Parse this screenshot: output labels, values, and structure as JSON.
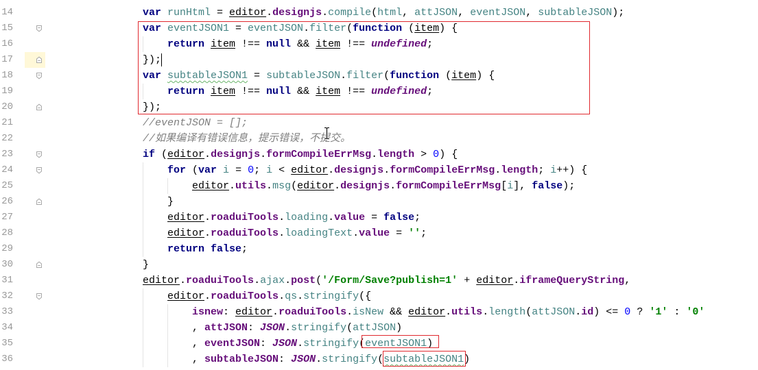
{
  "colors": {
    "background": "#FFFFFF",
    "line_number": "#999999",
    "plain": "#000000",
    "keyword": "#000080",
    "field": "#660E7A",
    "local_variable": "#458383",
    "string": "#008000",
    "number": "#0000FF",
    "comment": "#808080",
    "typo_underline": "#6AB56A",
    "indent_guide": "#E4E4E4",
    "fold_marker": "#A8A8A8",
    "caret_row": "#FFF8D8",
    "caret": "#000000",
    "annotation_box": "#E0282E"
  },
  "icons": {
    "fold_start": "fold-expanded-icon",
    "fold_end": "fold-end-icon",
    "mouse_cursor": "text-cursor-icon"
  },
  "editor": {
    "lines": [
      {
        "number": "14",
        "tokens": [
          "var ",
          "runHtml",
          " = ",
          "editor",
          ".",
          "designjs",
          ".",
          "compile",
          "(",
          "html",
          ", ",
          "attJSON",
          ", ",
          "eventJSON",
          ", ",
          "subtableJSON",
          ");"
        ]
      },
      {
        "number": "15",
        "tokens": [
          "var ",
          "eventJSON1",
          " = ",
          "eventJSON",
          ".",
          "filter",
          "(",
          "function ",
          "(",
          "item",
          ") {"
        ]
      },
      {
        "number": "16",
        "tokens": [
          "return ",
          "item",
          " !== ",
          "null",
          " && ",
          "item",
          " !== ",
          "undefined",
          ";"
        ]
      },
      {
        "number": "17",
        "tokens": [
          "});"
        ]
      },
      {
        "number": "18",
        "tokens": [
          "var ",
          "subtableJSON1",
          " = ",
          "subtableJSON",
          ".",
          "filter",
          "(",
          "function ",
          "(",
          "item",
          ") {"
        ]
      },
      {
        "number": "19",
        "tokens": [
          "return ",
          "item",
          " !== ",
          "null",
          " && ",
          "item",
          " !== ",
          "undefined",
          ";"
        ]
      },
      {
        "number": "20",
        "tokens": [
          "});"
        ]
      },
      {
        "number": "21",
        "tokens": [
          "//eventJSON = [];"
        ]
      },
      {
        "number": "22",
        "tokens": [
          "//如果编译有错误信息，提示错误，不提交。"
        ]
      },
      {
        "number": "23",
        "tokens": [
          "if ",
          "(",
          "editor",
          ".",
          "designjs",
          ".",
          "formCompileErrMsg",
          ".",
          "length",
          " > ",
          "0",
          ") {"
        ]
      },
      {
        "number": "24",
        "tokens": [
          "for ",
          "(",
          "var ",
          "i",
          " = ",
          "0",
          "; ",
          "i",
          " < ",
          "editor",
          ".",
          "designjs",
          ".",
          "formCompileErrMsg",
          ".",
          "length",
          "; ",
          "i",
          "++) {"
        ]
      },
      {
        "number": "25",
        "tokens": [
          "editor",
          ".",
          "utils",
          ".",
          "msg",
          "(",
          "editor",
          ".",
          "designjs",
          ".",
          "formCompileErrMsg",
          "[",
          "i",
          "], ",
          "false",
          ");"
        ]
      },
      {
        "number": "26",
        "tokens": [
          "}"
        ]
      },
      {
        "number": "27",
        "tokens": [
          "editor",
          ".",
          "roaduiTools",
          ".",
          "loading",
          ".",
          "value",
          " = ",
          "false",
          ";"
        ]
      },
      {
        "number": "28",
        "tokens": [
          "editor",
          ".",
          "roaduiTools",
          ".",
          "loadingText",
          ".",
          "value",
          " = ",
          "''",
          ";"
        ]
      },
      {
        "number": "29",
        "tokens": [
          "return false",
          ";"
        ]
      },
      {
        "number": "30",
        "tokens": [
          "}"
        ]
      },
      {
        "number": "31",
        "tokens": [
          "editor",
          ".",
          "roaduiTools",
          ".",
          "ajax",
          ".",
          "post",
          "(",
          "'/Form/Save?publish=1'",
          " + ",
          "editor",
          ".",
          "iframeQueryString",
          ","
        ]
      },
      {
        "number": "32",
        "tokens": [
          "editor",
          ".",
          "roaduiTools",
          ".",
          "qs",
          ".",
          "stringify",
          "({"
        ]
      },
      {
        "number": "33",
        "tokens": [
          "isnew",
          ": ",
          "editor",
          ".",
          "roaduiTools",
          ".",
          "isNew",
          " && ",
          "editor",
          ".",
          "utils",
          ".",
          "length",
          "(",
          "attJSON",
          ".",
          "id",
          ") <= ",
          "0",
          " ? ",
          "'1'",
          " : ",
          "'0'"
        ]
      },
      {
        "number": "34",
        "tokens": [
          ", ",
          "attJSON",
          ": ",
          "JSON",
          ".",
          "stringify",
          "(",
          "attJSON",
          ")"
        ]
      },
      {
        "number": "35",
        "tokens": [
          ", ",
          "eventJSON",
          ": ",
          "JSON",
          ".",
          "stringify",
          "(",
          "eventJSON1",
          ")"
        ]
      },
      {
        "number": "36",
        "tokens": [
          ", ",
          "subtableJSON",
          ": ",
          "JSON",
          ".",
          "stringify",
          "(",
          "subtableJSON1",
          ")"
        ]
      }
    ]
  }
}
